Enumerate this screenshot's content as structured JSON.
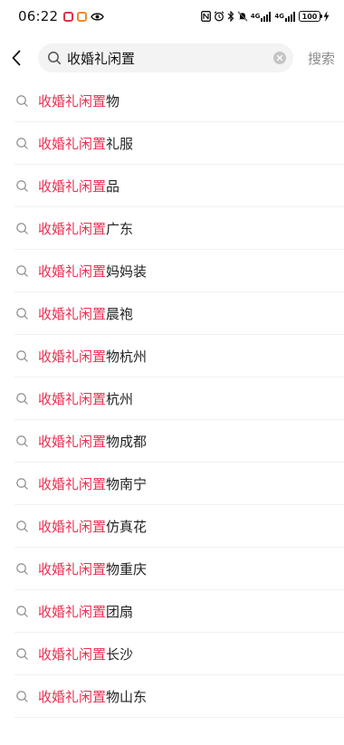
{
  "status_bar": {
    "time": "06:22",
    "network_label_1": "4G",
    "network_label_2": "4G",
    "battery": "100"
  },
  "colors": {
    "accent": "#ea2f52",
    "text": "#222222",
    "muted": "#8a8a8a",
    "field_bg": "#f3f3f3"
  },
  "search": {
    "query": "收婚礼闲置",
    "submit_label": "搜索"
  },
  "icons": {
    "back": "chevron-left-icon",
    "search": "search-icon",
    "clear": "clear-icon",
    "suggestion": "search-icon"
  },
  "suggestions": [
    {
      "highlight": "收婚礼闲置",
      "rest": "物"
    },
    {
      "highlight": "收婚礼闲置",
      "rest": "礼服"
    },
    {
      "highlight": "收婚礼闲置",
      "rest": "品"
    },
    {
      "highlight": "收婚礼闲置",
      "rest": "广东"
    },
    {
      "highlight": "收婚礼闲置",
      "rest": "妈妈装"
    },
    {
      "highlight": "收婚礼闲置",
      "rest": "晨袍"
    },
    {
      "highlight": "收婚礼闲置",
      "rest": "物杭州"
    },
    {
      "highlight": "收婚礼闲置",
      "rest": "杭州"
    },
    {
      "highlight": "收婚礼闲置",
      "rest": "物成都"
    },
    {
      "highlight": "收婚礼闲置",
      "rest": "物南宁"
    },
    {
      "highlight": "收婚礼闲置",
      "rest": "仿真花"
    },
    {
      "highlight": "收婚礼闲置",
      "rest": "物重庆"
    },
    {
      "highlight": "收婚礼闲置",
      "rest": "团扇"
    },
    {
      "highlight": "收婚礼闲置",
      "rest": "长沙"
    },
    {
      "highlight": "收婚礼闲置",
      "rest": "物山东"
    }
  ]
}
